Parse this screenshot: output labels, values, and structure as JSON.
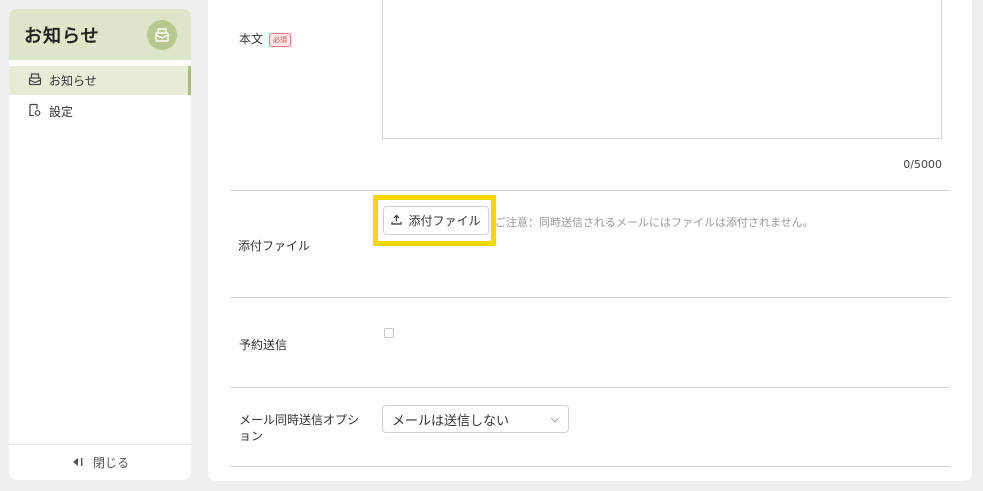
{
  "sidebar": {
    "title": "お知らせ",
    "app_icon": "megaphone-icon",
    "items": [
      {
        "label": "お知らせ",
        "icon": "notice-icon",
        "active": true
      },
      {
        "label": "設定",
        "icon": "settings-doc-icon",
        "active": false
      }
    ],
    "footer": {
      "label": "閉じる",
      "icon": "collapse-left-icon"
    }
  },
  "form": {
    "body": {
      "label": "本文",
      "required_badge": "必須",
      "value": "",
      "counter": "0/5000"
    },
    "attachment": {
      "label": "添付ファイル",
      "button_label": "添付ファイル",
      "button_icon": "upload-icon",
      "note": "ご注意：同時送信されるメールにはファイルは添付されません。"
    },
    "schedule": {
      "label": "予約送信",
      "checked": false
    },
    "mail_option": {
      "label": "メール同時送信オプション",
      "selected": "メールは送信しない"
    }
  },
  "colors": {
    "sidebar_header": "#dde6c8",
    "active_nav": "#e6ecd8",
    "accent": "#a8bf7a",
    "highlight": "#f4d800"
  }
}
